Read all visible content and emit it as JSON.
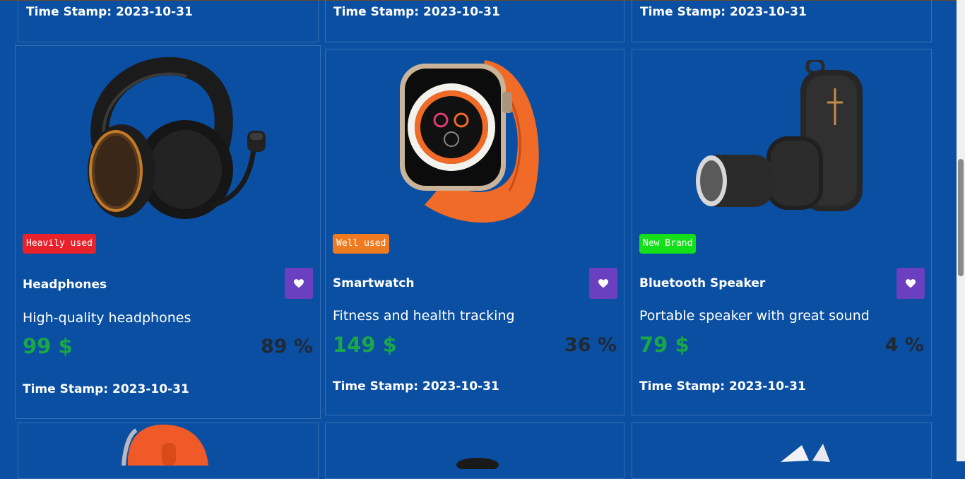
{
  "colors": {
    "page_background": "#0a4fa1",
    "price_green": "#1aa64a",
    "favorite_button": "#6a3fc0",
    "badge_heavily_used": "#e8212b",
    "badge_well_used": "#f07a1f",
    "badge_new_brand": "#14e01a"
  },
  "top_row": [
    {
      "timestamp": "Time Stamp: 2023-10-31"
    },
    {
      "timestamp": "Time Stamp: 2023-10-31"
    },
    {
      "timestamp": "Time Stamp: 2023-10-31"
    }
  ],
  "products": [
    {
      "image_icon": "headphones-image",
      "badge": "Heavily used",
      "name": "Headphones",
      "description": "High-quality headphones",
      "price": "99 $",
      "percent": "89 %",
      "timestamp": "Time Stamp: 2023-10-31",
      "favorite_icon": "heart-icon"
    },
    {
      "image_icon": "smartwatch-image",
      "badge": "Well used",
      "name": "Smartwatch",
      "description": "Fitness and health tracking",
      "price": "149 $",
      "percent": "36 %",
      "timestamp": "Time Stamp: 2023-10-31",
      "favorite_icon": "heart-icon"
    },
    {
      "image_icon": "bluetooth-speaker-image",
      "badge": "New Brand",
      "name": "Bluetooth Speaker",
      "description": "Portable speaker with great sound",
      "price": "79 $",
      "percent": "4 %",
      "timestamp": "Time Stamp: 2023-10-31",
      "favorite_icon": "heart-icon"
    }
  ],
  "bottom_row_images": [
    "computer-mouse-image",
    "product-image",
    "product-image"
  ]
}
